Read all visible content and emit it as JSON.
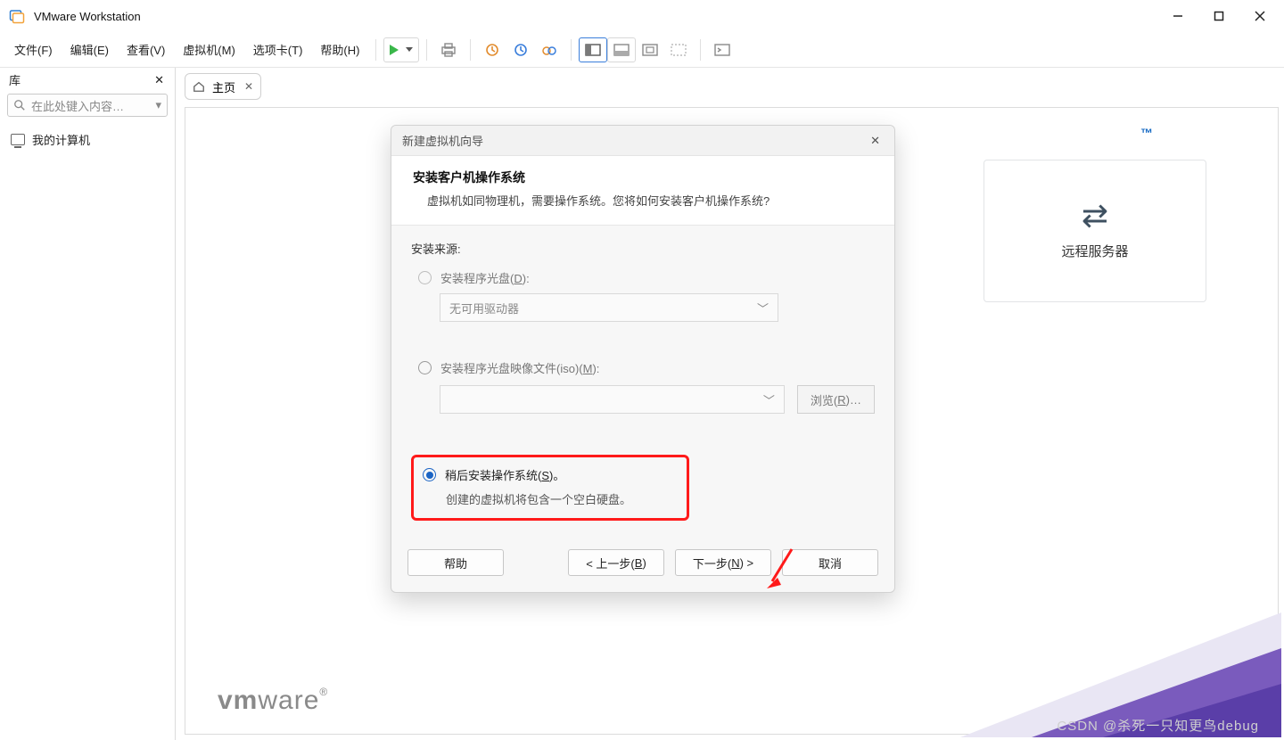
{
  "app": {
    "title": "VMware Workstation"
  },
  "menu": {
    "file": "文件(F)",
    "edit": "编辑(E)",
    "view": "查看(V)",
    "vm": "虚拟机(M)",
    "tabs": "选项卡(T)",
    "help": "帮助(H)"
  },
  "sidebar": {
    "lib_label": "库",
    "search_placeholder": "在此处键入内容…",
    "tree": {
      "my_computer": "我的计算机"
    }
  },
  "tabs": {
    "home": "主页"
  },
  "bgcard": {
    "label": "远程服务器",
    "tm": "™"
  },
  "logo": {
    "brand_bold": "vm",
    "brand_rest": "ware",
    "reg": "®"
  },
  "dialog": {
    "title": "新建虚拟机向导",
    "heading": "安装客户机操作系统",
    "subheading": "虚拟机如同物理机，需要操作系统。您将如何安装客户机操作系统?",
    "source_label": "安装来源:",
    "opt_disc": "安装程序光盘(D):",
    "disc_combo": "无可用驱动器",
    "opt_iso": "安装程序光盘映像文件(iso)(M):",
    "browse": "浏览(R)…",
    "opt_later": "稍后安装操作系统(S)。",
    "later_sub": "创建的虚拟机将包含一个空白硬盘。",
    "btn_help": "帮助",
    "btn_back": "< 上一步(B)",
    "btn_next": "下一步(N) >",
    "btn_cancel": "取消"
  },
  "watermark": "CSDN @杀死一只知更鸟debug"
}
